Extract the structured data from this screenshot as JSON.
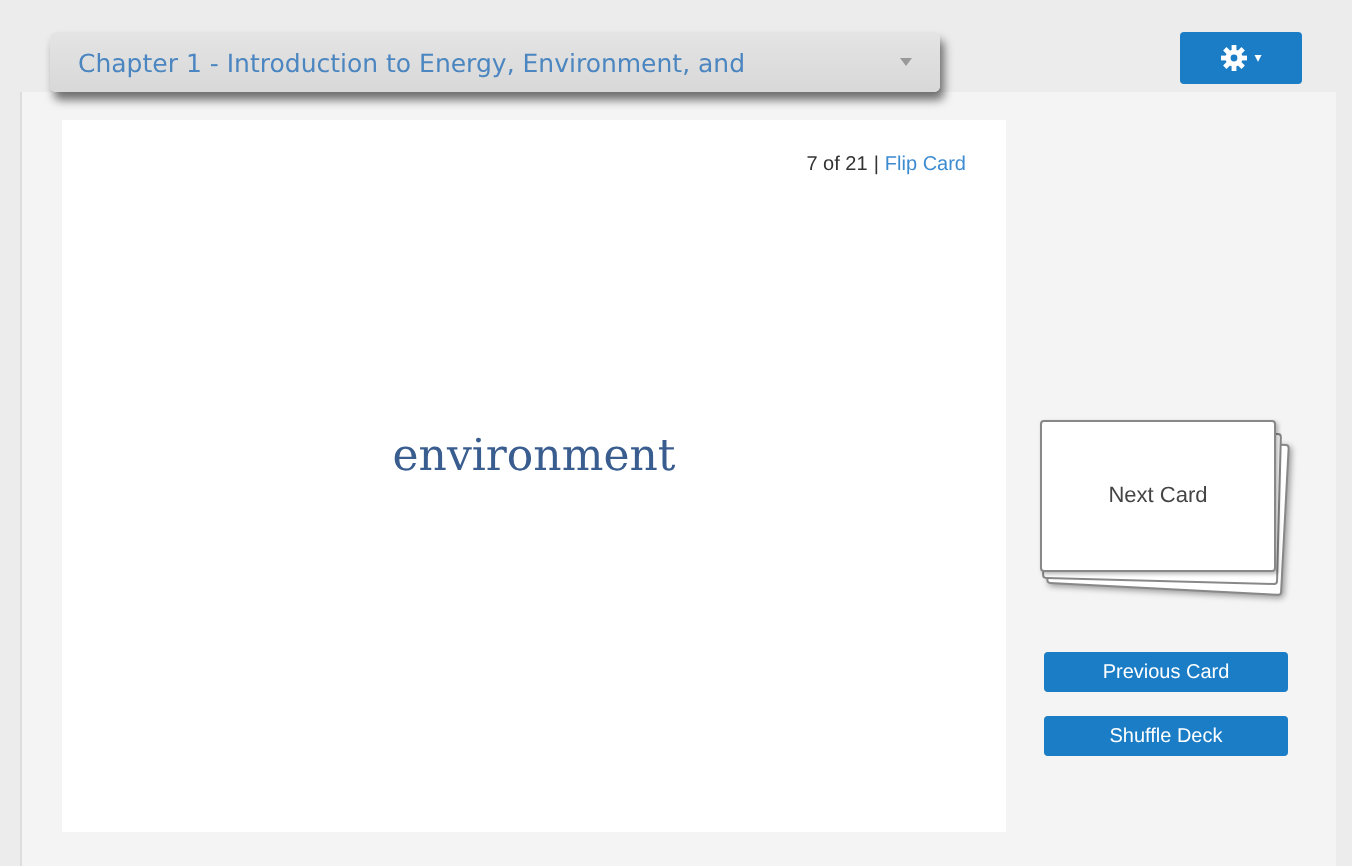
{
  "deck_select": {
    "value": "Chapter 1 - Introduction to Energy, Environment, and"
  },
  "settings_button": {
    "caret": "▾"
  },
  "card": {
    "position": "7 of 21",
    "separator": "|",
    "flip_link": "Flip Card",
    "term": "environment"
  },
  "next_card": {
    "label": "Next Card"
  },
  "buttons": [
    {
      "label": "Previous Card"
    },
    {
      "label": "Shuffle Deck"
    }
  ]
}
